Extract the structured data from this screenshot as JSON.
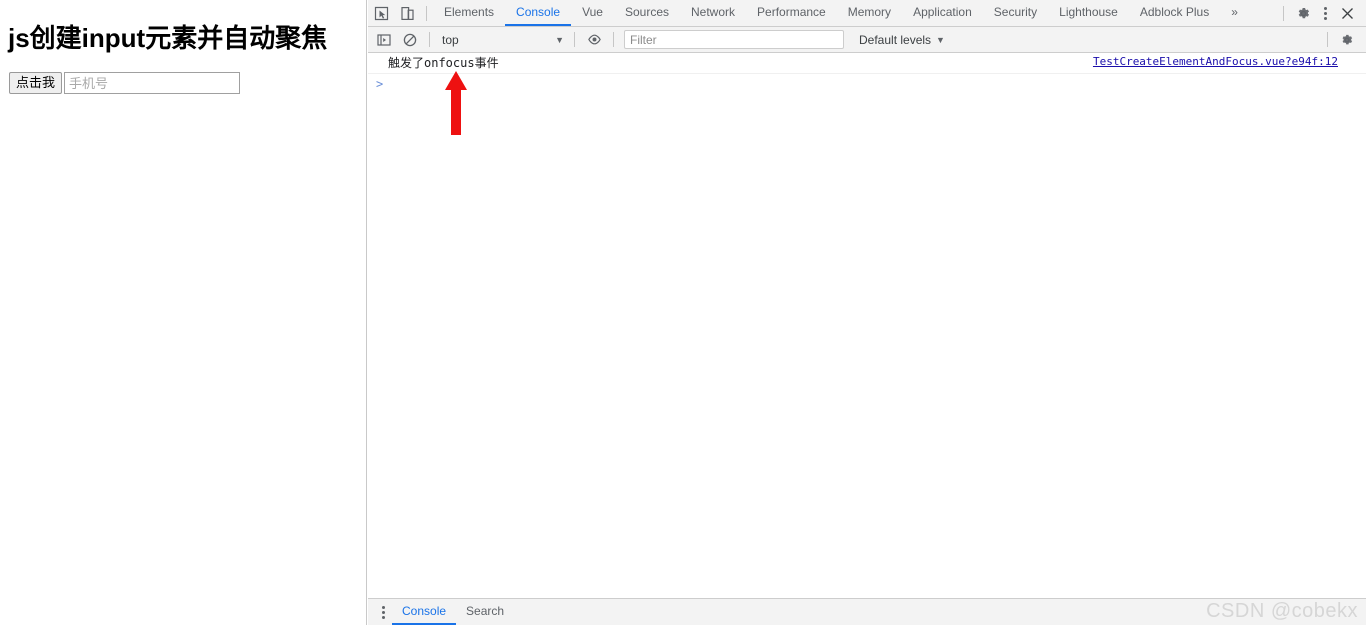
{
  "page": {
    "title": "js创建input元素并自动聚焦",
    "button_label": "点击我",
    "input_value": "",
    "input_placeholder": "手机号"
  },
  "devtools": {
    "toolbar_icons": [
      {
        "name": "inspect-element-icon",
        "label": "inspect-element-icon"
      },
      {
        "name": "device-toolbar-icon",
        "label": "device-toolbar-icon"
      }
    ],
    "tabs": [
      {
        "label": "Elements",
        "active": false
      },
      {
        "label": "Console",
        "active": true
      },
      {
        "label": "Vue",
        "active": false
      },
      {
        "label": "Sources",
        "active": false
      },
      {
        "label": "Network",
        "active": false
      },
      {
        "label": "Performance",
        "active": false
      },
      {
        "label": "Memory",
        "active": false
      },
      {
        "label": "Application",
        "active": false
      },
      {
        "label": "Security",
        "active": false
      },
      {
        "label": "Lighthouse",
        "active": false
      },
      {
        "label": "Adblock Plus",
        "active": false
      }
    ],
    "overflow_label": "»",
    "right_icons": [
      {
        "name": "settings-gear-icon",
        "label": "gear-icon"
      },
      {
        "name": "more-options-icon",
        "label": "kebab-icon"
      },
      {
        "name": "close-devtools-icon",
        "label": "close-icon"
      }
    ],
    "accent_color": "#1a73e8"
  },
  "console_toolbar": {
    "sidebar_toggle": "console-sidebar-icon",
    "clear_console": "clear-console-icon",
    "context": "top",
    "context_caret": "▼",
    "eye_icon": "live-expression-eye-icon",
    "filter_value": "",
    "filter_placeholder": "Filter",
    "levels_label": "Default levels",
    "levels_caret": "▼",
    "settings_icon": "console-settings-gear-icon"
  },
  "console": {
    "messages": [
      {
        "text": "触发了onfocus事件",
        "source": "TestCreateElementAndFocus.vue?e94f:12"
      }
    ],
    "prompt": ">",
    "annotation": {
      "name": "red-arrow-annotation",
      "color": "#ee1111",
      "direction": "up"
    }
  },
  "drawer": {
    "menu_icon": "drawer-more-icon",
    "tabs": [
      {
        "label": "Console",
        "active": true
      },
      {
        "label": "Search",
        "active": false
      }
    ]
  },
  "watermark": {
    "text": "CSDN @cobekx"
  }
}
